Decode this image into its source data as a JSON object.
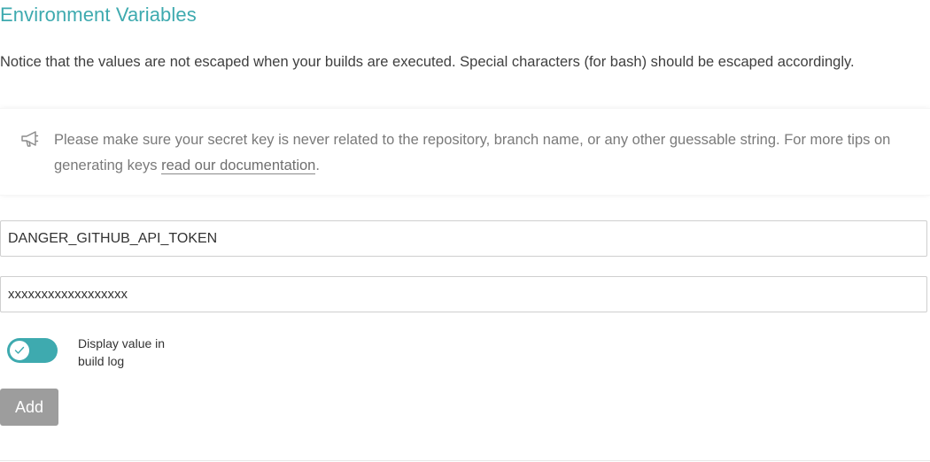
{
  "section": {
    "title": "Environment Variables",
    "notice": "Notice that the values are not escaped when your builds are executed. Special characters (for bash) should be escaped accordingly."
  },
  "tip": {
    "icon": "megaphone-icon",
    "text": "Please make sure your secret key is never related to the repository, branch name, or any other guessable string. For more tips on generating keys ",
    "link_label": "read our documentation",
    "suffix": "."
  },
  "form": {
    "name_value": "DANGER_GITHUB_API_TOKEN",
    "value_value": "xxxxxxxxxxxxxxxxxx",
    "display_toggle_label": "Display value in build log",
    "display_toggle_on": true,
    "add_label": "Add"
  },
  "colors": {
    "accent": "#3eaaaf",
    "button_disabled": "#9d9d9d"
  }
}
